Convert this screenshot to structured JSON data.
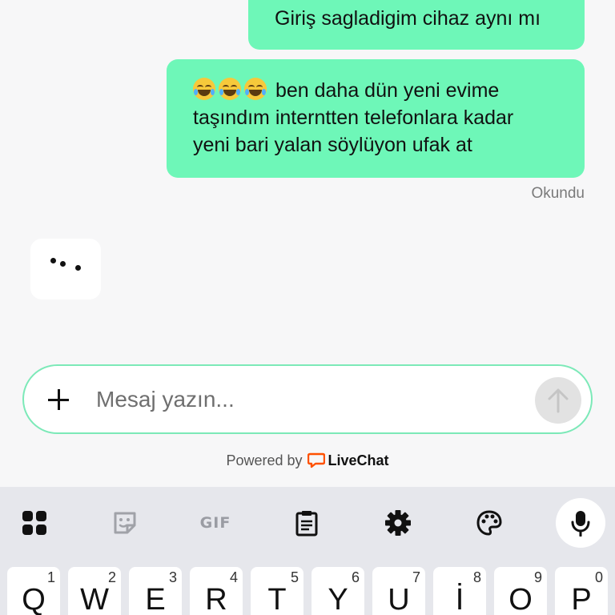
{
  "messages": [
    {
      "lines": [
        "Giriş sagladigim cihaz aynı mı"
      ]
    },
    {
      "emoji": [
        "face-with-tears-of-joy",
        "face-with-tears-of-joy",
        "face-with-tears-of-joy"
      ],
      "lines": [
        "ben daha dün yeni evime",
        "taşındım interntten telefonlara kadar",
        "yeni bari yalan söylüyon ufak at"
      ]
    }
  ],
  "read_status": "Okundu",
  "typing_indicator": {
    "icon": "typing-dots-icon"
  },
  "composer": {
    "placeholder": "Mesaj yazın...",
    "add_icon": "plus-icon",
    "send_icon": "arrow-up-icon"
  },
  "powered_by": {
    "prefix": "Powered by",
    "brand": "LiveChat",
    "brand_color": "#ff5100"
  },
  "colors": {
    "bubble": "#6ef7b8",
    "input_border": "#7ce9b8",
    "keyboard_bg": "#e6e7ec"
  },
  "keyboard": {
    "toolbar": [
      {
        "name": "apps-icon"
      },
      {
        "name": "sticker-icon"
      },
      {
        "name": "gif-button",
        "label": "GIF"
      },
      {
        "name": "clipboard-icon"
      },
      {
        "name": "gear-icon"
      },
      {
        "name": "palette-icon"
      },
      {
        "name": "microphone-icon"
      }
    ],
    "top_row": [
      {
        "letter": "Q",
        "num": "1"
      },
      {
        "letter": "W",
        "num": "2"
      },
      {
        "letter": "E",
        "num": "3"
      },
      {
        "letter": "R",
        "num": "4"
      },
      {
        "letter": "T",
        "num": "5"
      },
      {
        "letter": "Y",
        "num": "6"
      },
      {
        "letter": "U",
        "num": "7"
      },
      {
        "letter": "İ",
        "num": "8"
      },
      {
        "letter": "O",
        "num": "9"
      },
      {
        "letter": "P",
        "num": "0"
      }
    ]
  }
}
